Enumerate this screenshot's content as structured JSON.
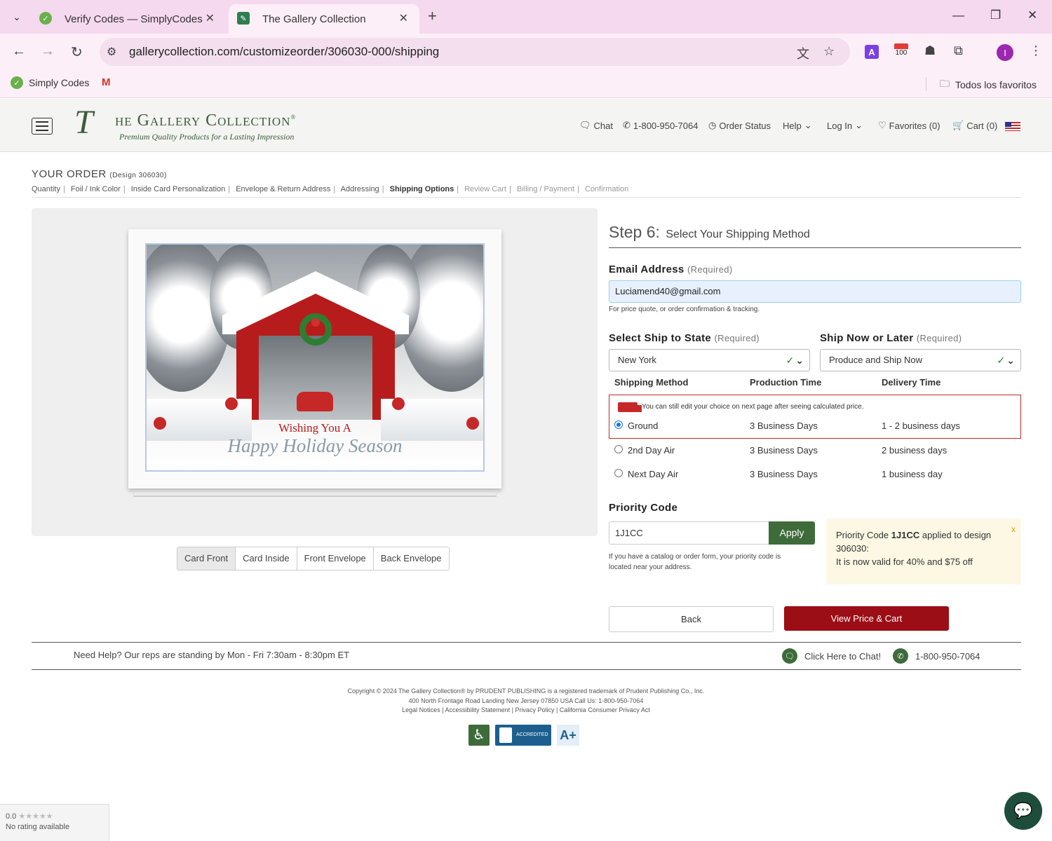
{
  "browser": {
    "tabs": [
      {
        "title": "Verify Codes — SimplyCodes",
        "active": false
      },
      {
        "title": "The Gallery Collection",
        "active": true
      }
    ],
    "url": "gallerycollection.com/customizeorder/306030-000/shipping",
    "ext_calendar_badge": "100",
    "profile_initial": "I",
    "bookmarks": [
      {
        "label": "Simply Codes"
      },
      {
        "label": "M"
      }
    ],
    "all_favorites": "Todos los favoritos"
  },
  "site": {
    "logo_big": "T",
    "logo_name": "he Gallery Collection",
    "logo_reg": "®",
    "logo_tagline": "Premium Quality Products for a Lasting Impression",
    "nav": {
      "chat": "Chat",
      "phone": "1-800-950-7064",
      "order_status": "Order Status",
      "help": "Help",
      "login": "Log In",
      "favorites": "Favorites (0)",
      "cart": "Cart (0)"
    }
  },
  "order": {
    "title": "YOUR ORDER",
    "design": "(Design 306030)",
    "steps": [
      {
        "label": "Quantity",
        "state": "done"
      },
      {
        "label": "Foil / Ink Color",
        "state": "done"
      },
      {
        "label": "Inside Card Personalization",
        "state": "done"
      },
      {
        "label": "Envelope & Return Address",
        "state": "done"
      },
      {
        "label": "Addressing",
        "state": "done"
      },
      {
        "label": "Shipping Options",
        "state": "active"
      },
      {
        "label": "Review Cart",
        "state": "todo"
      },
      {
        "label": "Billing / Payment",
        "state": "todo"
      },
      {
        "label": "Confirmation",
        "state": "todo"
      }
    ]
  },
  "preview": {
    "greeting_line1": "Wishing You A",
    "greeting_line2": "Happy Holiday Season",
    "view_tabs": [
      "Card Front",
      "Card Inside",
      "Front Envelope",
      "Back Envelope"
    ],
    "active_view": "Card Front"
  },
  "form": {
    "step_num": "Step 6:",
    "step_label": "Select Your Shipping Method",
    "email_label": "Email Address",
    "required": "(Required)",
    "email_value": "Luciamend40@gmail.com",
    "email_hint": "For price quote, or order confirmation & tracking.",
    "state_label": "Select Ship to State",
    "state_value": "New York",
    "when_label": "Ship Now or Later",
    "when_value": "Produce and Ship Now",
    "col_method": "Shipping Method",
    "col_production": "Production Time",
    "col_delivery": "Delivery Time",
    "edit_note": "You can still edit your choice on next page after seeing calculated price.",
    "methods": [
      {
        "name": "Ground",
        "production": "3 Business Days",
        "delivery": "1 - 2 business days",
        "selected": true
      },
      {
        "name": "2nd Day Air",
        "production": "3 Business Days",
        "delivery": "2 business days",
        "selected": false
      },
      {
        "name": "Next Day Air",
        "production": "3 Business Days",
        "delivery": "1 business day",
        "selected": false
      }
    ],
    "priority_label": "Priority Code",
    "priority_value": "1J1CC",
    "apply_label": "Apply",
    "priority_hint_1": "If you have a catalog or order form, your priority code is",
    "priority_hint_2": "located near your address.",
    "promo_line1_pre": "Priority Code",
    "promo_code": "1J1CC",
    "promo_line1_post": "applied to design",
    "promo_design": "306030:",
    "promo_line3": "It is now valid for 40% and $75 off",
    "promo_close": "x",
    "back_label": "Back",
    "cart_label": "View Price & Cart"
  },
  "help": {
    "text": "Need Help? Our reps are standing by Mon - Fri 7:30am - 8:30pm ET",
    "chat": "Click Here to Chat!",
    "phone": "1-800-950-7064"
  },
  "footer": {
    "line1": "Copyright © 2024 The Gallery Collection® by PRUDENT PUBLISHING is a registered trademark of Prudent Publishing Co., Inc.",
    "line2": "400 North Frontage Road Landing New Jersey 07850 USA Call Us: 1-800-950-7064",
    "links": [
      "Legal Notices",
      "Accessibility Statement",
      "Privacy Policy",
      "California Consumer Privacy Act"
    ],
    "bbb_text": "ACCREDITED BUSINESS",
    "bbb_rating": "A+"
  },
  "rating": {
    "score": "0.0",
    "stars": "★★★★★",
    "text": "No rating available"
  }
}
